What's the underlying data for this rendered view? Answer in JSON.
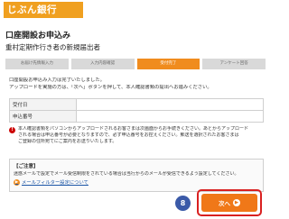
{
  "header": {
    "logo_text": "じぶん銀行"
  },
  "page": {
    "title": "口座開設お申込み",
    "subtitle": "重村定期作行き者の新規届出者"
  },
  "steps": [
    {
      "label": "お届け先情報入力"
    },
    {
      "label": "入力内容確認"
    },
    {
      "label": "受付完了"
    },
    {
      "label": "アンケート回答"
    }
  ],
  "intro": {
    "line1": "口座開設お申込み入力は完了いたしました。",
    "line2": "アップロードを実施の方は、「次へ」ボタンを押して、本人確認書類の提出へお進みください。"
  },
  "info_table": [
    {
      "label": "受付日",
      "value": ""
    },
    {
      "label": "申込番号",
      "value": ""
    }
  ],
  "notice": {
    "icon": "!",
    "line1": "本人確認書類をパソコンからアップロードされるお客さまは次画面からお手続きください。あとからアップロード",
    "line2": "される場合は申込番号が必要となりますので、必ず申込番号をお控えください。郵送を選択されたお客さまは",
    "line3": "ご登録の住所宛てにご案内をお送りいたします。"
  },
  "caution": {
    "title": "【ご注意】",
    "text": "迷惑メールで設定でメール受信制限をされている場合は当行からのメールが受信できるよう設定してください。",
    "link_label": "メールフィルター設定について"
  },
  "marker": {
    "label": "8"
  },
  "next_button": {
    "label": "次へ"
  },
  "colors": {
    "brand": "#f0a020",
    "step_active": "#f08c1e",
    "button": "#f07818",
    "highlight_border": "#d92020",
    "marker": "#3b5aa8"
  }
}
